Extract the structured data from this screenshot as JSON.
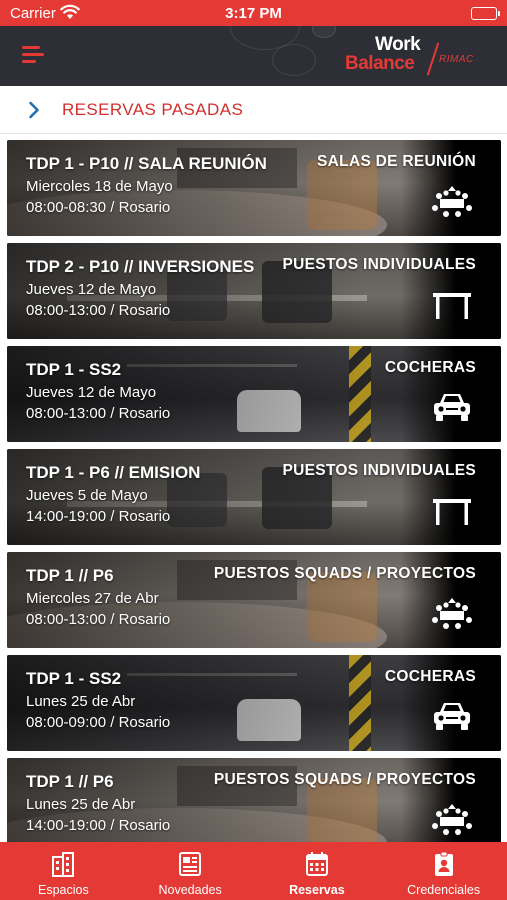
{
  "status_bar": {
    "carrier": "Carrier",
    "time": "3:17 PM",
    "battery_level": 1.0
  },
  "header": {
    "brand_line1": "Work",
    "brand_line2": "Balance",
    "brand_sub": "RIMAC"
  },
  "section": {
    "title": "RESERVAS PASADAS"
  },
  "reservations": [
    {
      "title": "TDP 1 - P10 // SALA REUNIÓN",
      "date": "Miercoles 18 de Mayo",
      "time_place": "08:00-08:30 / Rosario",
      "category": "SALAS DE REUNIÓN",
      "icon": "meeting-room-icon"
    },
    {
      "title": "TDP 2 - P10 // INVERSIONES",
      "date": "Jueves 12 de Mayo",
      "time_place": "08:00-13:00 / Rosario",
      "category": "PUESTOS INDIVIDUALES",
      "icon": "desk-icon"
    },
    {
      "title": "TDP 1 - SS2",
      "date": "Jueves 12 de Mayo",
      "time_place": "08:00-13:00 / Rosario",
      "category": "COCHERAS",
      "icon": "car-icon"
    },
    {
      "title": "TDP 1 - P6 // EMISION",
      "date": "Jueves 5 de Mayo",
      "time_place": "14:00-19:00 / Rosario",
      "category": "PUESTOS INDIVIDUALES",
      "icon": "desk-icon"
    },
    {
      "title": "TDP 1 // P6",
      "date": "Miercoles 27 de Abr",
      "time_place": "08:00-13:00 / Rosario",
      "category": "PUESTOS SQUADS / PROYECTOS",
      "icon": "meeting-room-icon"
    },
    {
      "title": "TDP 1 - SS2",
      "date": "Lunes 25 de Abr",
      "time_place": "08:00-09:00 / Rosario",
      "category": "COCHERAS",
      "icon": "car-icon"
    },
    {
      "title": "TDP 1 // P6",
      "date": "Lunes 25 de Abr",
      "time_place": "14:00-19:00 / Rosario",
      "category": "PUESTOS SQUADS / PROYECTOS",
      "icon": "meeting-room-icon"
    }
  ],
  "bottom_nav": [
    {
      "label": "Espacios",
      "icon": "building-icon"
    },
    {
      "label": "Novedades",
      "icon": "newspaper-icon"
    },
    {
      "label": "Reservas",
      "icon": "calendar-icon",
      "active": true
    },
    {
      "label": "Credenciales",
      "icon": "badge-icon"
    }
  ],
  "colors": {
    "primary": "#e53935",
    "header_bg": "#2e2f36",
    "section_title": "#d32f2f"
  }
}
